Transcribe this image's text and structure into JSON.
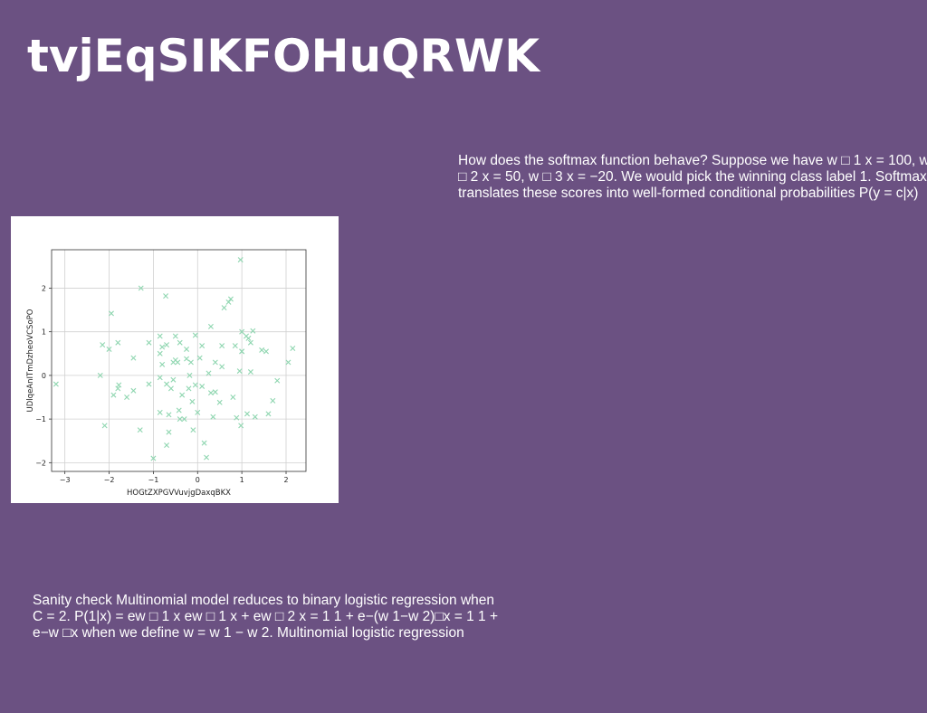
{
  "title": "tvjEqSIKFOHuQRWK",
  "paragraph_top": {
    "lines": [
      "How does the softmax function behave? Suppose we have w □ 1 x = 100, w",
      "□ 2 x = 50, w □ 3 x = −20. We would pick the winning class label 1. Softmax",
      "translates these scores into well-formed conditional probabilities P(y = c|x)"
    ]
  },
  "paragraph_bottom": {
    "lines": [
      "Sanity check Multinomial model reduces to binary logistic regression when",
      "C = 2. P(1|x) = ew □ 1 x ew □ 1 x + ew □ 2 x = 1 1 + e−(w 1−w 2)□x = 1 1 +",
      "e−w □x when we define w = w 1 − w 2. Multinomial logistic regression"
    ]
  },
  "colors": {
    "background": "#6b5182",
    "marker": "#8fd6b0",
    "panel": "#ffffff"
  },
  "chart_data": {
    "type": "scatter",
    "marker": "x",
    "xlabel": "HOGtZXPGVVuvjgDaxqBKX",
    "ylabel": "UDlqeAnITmDzheoVCSoPO",
    "xlim": [
      -3.3,
      2.45
    ],
    "ylim": [
      -2.2,
      2.88
    ],
    "xticks": [
      -3,
      -2,
      -1,
      0,
      1,
      2
    ],
    "yticks": [
      -2,
      -1,
      0,
      1,
      2
    ],
    "grid": true,
    "points": [
      [
        -3.2,
        -0.2
      ],
      [
        -2.2,
        0.0
      ],
      [
        -2.15,
        0.7
      ],
      [
        -2.1,
        -1.15
      ],
      [
        -2.0,
        0.6
      ],
      [
        -1.95,
        1.42
      ],
      [
        -1.9,
        -0.45
      ],
      [
        -1.8,
        0.75
      ],
      [
        -1.8,
        -0.3
      ],
      [
        -1.78,
        -0.22
      ],
      [
        -1.6,
        -0.5
      ],
      [
        -1.45,
        0.4
      ],
      [
        -1.45,
        -0.35
      ],
      [
        -1.3,
        -1.25
      ],
      [
        -1.28,
        2.0
      ],
      [
        -1.1,
        0.75
      ],
      [
        -1.1,
        -0.2
      ],
      [
        -1.0,
        -1.9
      ],
      [
        -0.85,
        0.9
      ],
      [
        -0.85,
        0.5
      ],
      [
        -0.85,
        -0.05
      ],
      [
        -0.85,
        -0.85
      ],
      [
        -0.8,
        0.65
      ],
      [
        -0.8,
        0.25
      ],
      [
        -0.72,
        1.82
      ],
      [
        -0.7,
        0.7
      ],
      [
        -0.7,
        -0.2
      ],
      [
        -0.7,
        -1.6
      ],
      [
        -0.65,
        -1.3
      ],
      [
        -0.65,
        -0.9
      ],
      [
        -0.6,
        -0.3
      ],
      [
        -0.55,
        0.3
      ],
      [
        -0.55,
        -0.1
      ],
      [
        -0.5,
        0.35
      ],
      [
        -0.5,
        0.9
      ],
      [
        -0.45,
        0.3
      ],
      [
        -0.42,
        -0.8
      ],
      [
        -0.4,
        0.75
      ],
      [
        -0.4,
        -1.0
      ],
      [
        -0.35,
        -0.45
      ],
      [
        -0.3,
        -1.0
      ],
      [
        -0.25,
        0.6
      ],
      [
        -0.25,
        0.38
      ],
      [
        -0.2,
        -0.3
      ],
      [
        -0.18,
        0.0
      ],
      [
        -0.15,
        0.3
      ],
      [
        -0.12,
        -0.6
      ],
      [
        -0.1,
        -1.25
      ],
      [
        -0.05,
        0.92
      ],
      [
        -0.05,
        -0.22
      ],
      [
        0.0,
        -0.85
      ],
      [
        0.05,
        0.4
      ],
      [
        0.1,
        0.68
      ],
      [
        0.1,
        -0.25
      ],
      [
        0.15,
        -1.55
      ],
      [
        0.2,
        -1.88
      ],
      [
        0.25,
        0.05
      ],
      [
        0.3,
        1.12
      ],
      [
        0.3,
        -0.4
      ],
      [
        0.35,
        -0.95
      ],
      [
        0.4,
        0.3
      ],
      [
        0.4,
        -0.38
      ],
      [
        0.5,
        -0.62
      ],
      [
        0.55,
        0.68
      ],
      [
        0.55,
        0.2
      ],
      [
        0.6,
        1.55
      ],
      [
        0.7,
        1.68
      ],
      [
        0.75,
        1.75
      ],
      [
        0.8,
        -0.5
      ],
      [
        0.85,
        0.68
      ],
      [
        0.88,
        -0.97
      ],
      [
        0.95,
        0.1
      ],
      [
        0.97,
        2.65
      ],
      [
        0.98,
        -1.15
      ],
      [
        1.0,
        0.55
      ],
      [
        1.0,
        0.55
      ],
      [
        1.0,
        1.0
      ],
      [
        1.1,
        0.9
      ],
      [
        1.12,
        -0.88
      ],
      [
        1.15,
        0.85
      ],
      [
        1.2,
        0.08
      ],
      [
        1.2,
        0.75
      ],
      [
        1.25,
        1.02
      ],
      [
        1.3,
        -0.95
      ],
      [
        1.45,
        0.58
      ],
      [
        1.55,
        0.55
      ],
      [
        1.6,
        -0.88
      ],
      [
        1.7,
        -0.58
      ],
      [
        1.8,
        -0.12
      ],
      [
        2.05,
        0.3
      ],
      [
        2.15,
        0.62
      ]
    ]
  }
}
